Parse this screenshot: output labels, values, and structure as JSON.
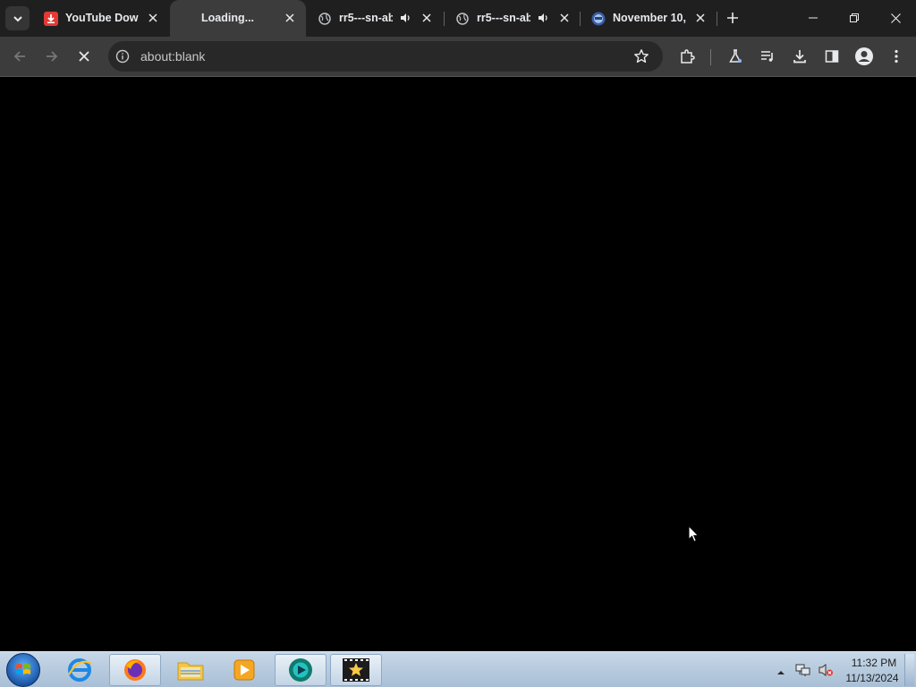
{
  "browser": {
    "tabs": [
      {
        "title": "YouTube Down",
        "favicon": "youtube-downloader-icon",
        "active": false
      },
      {
        "title": "Loading...",
        "favicon": "loading-spinner-icon",
        "active": true
      },
      {
        "title": "rr5---sn-ab",
        "favicon": "globe-icon",
        "audio": true,
        "active": false
      },
      {
        "title": "rr5---sn-ab",
        "favicon": "globe-icon",
        "audio": true,
        "active": false
      },
      {
        "title": "November 10,",
        "favicon": "site-logo-icon",
        "active": false
      }
    ],
    "omnibox": {
      "url": "about:blank"
    },
    "colors": {
      "tabstrip": "#1f1f1f",
      "toolbar": "#3c3c3c",
      "omnibox": "#282828",
      "content": "#000000"
    }
  },
  "taskbar": {
    "apps": [
      "windows-start",
      "internet-explorer",
      "firefox",
      "file-explorer",
      "media-player",
      "browser-app",
      "movie-maker"
    ],
    "clock": {
      "time": "11:32 PM",
      "date": "11/13/2024"
    }
  }
}
